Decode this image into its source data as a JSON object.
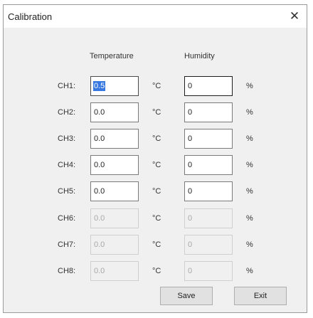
{
  "window": {
    "title": "Calibration",
    "close_glyph": "✕"
  },
  "columns": {
    "temperature": "Temperature",
    "humidity": "Humidity"
  },
  "units": {
    "temperature": "°C",
    "humidity": "%"
  },
  "channels": [
    {
      "label": "CH1:",
      "temperature": "0.5",
      "humidity": "0",
      "enabled": true,
      "temperature_selected": true
    },
    {
      "label": "CH2:",
      "temperature": "0.0",
      "humidity": "0",
      "enabled": true
    },
    {
      "label": "CH3:",
      "temperature": "0.0",
      "humidity": "0",
      "enabled": true
    },
    {
      "label": "CH4:",
      "temperature": "0.0",
      "humidity": "0",
      "enabled": true
    },
    {
      "label": "CH5:",
      "temperature": "0.0",
      "humidity": "0",
      "enabled": true
    },
    {
      "label": "CH6:",
      "temperature": "0.0",
      "humidity": "0",
      "enabled": false
    },
    {
      "label": "CH7:",
      "temperature": "0.0",
      "humidity": "0",
      "enabled": false
    },
    {
      "label": "CH8:",
      "temperature": "0.0",
      "humidity": "0",
      "enabled": false
    }
  ],
  "buttons": {
    "save": "Save",
    "exit": "Exit"
  },
  "colors": {
    "selection": "#3779e0",
    "window_bg": "#f0f0f0"
  },
  "icons": {
    "close": "close-icon"
  }
}
